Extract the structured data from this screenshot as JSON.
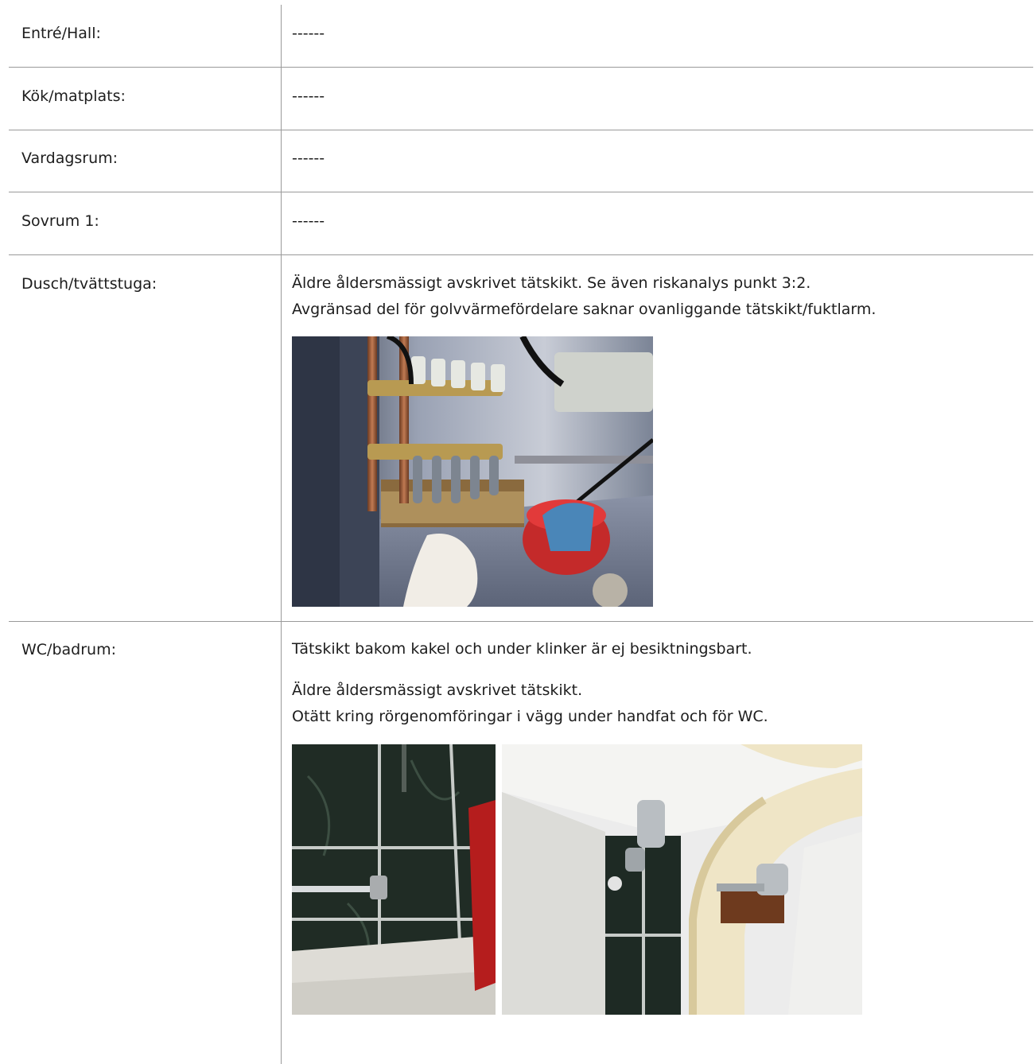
{
  "rows": [
    {
      "label": "Entré/Hall:",
      "value": "------"
    },
    {
      "label": "Kök/matplats:",
      "value": "------"
    },
    {
      "label": "Vardagsrum:",
      "value": "------"
    },
    {
      "label": "Sovrum 1:",
      "value": "------"
    },
    {
      "label": "Dusch/tvättstuga:",
      "lines": [
        "Äldre åldersmässigt avskrivet tätskikt. Se även riskanalys punkt 3:2.",
        "Avgränsad del för golvvärmefördelare saknar ovanliggande tätskikt/fuktlarm."
      ]
    },
    {
      "label": "WC/badrum:",
      "lines": [
        "Tätskikt bakom kakel och under klinker är ej besiktningsbart.",
        "Äldre åldersmässigt avskrivet tätskikt.",
        "Otätt kring rörgenomföringar i vägg under handfat och för WC."
      ]
    }
  ]
}
